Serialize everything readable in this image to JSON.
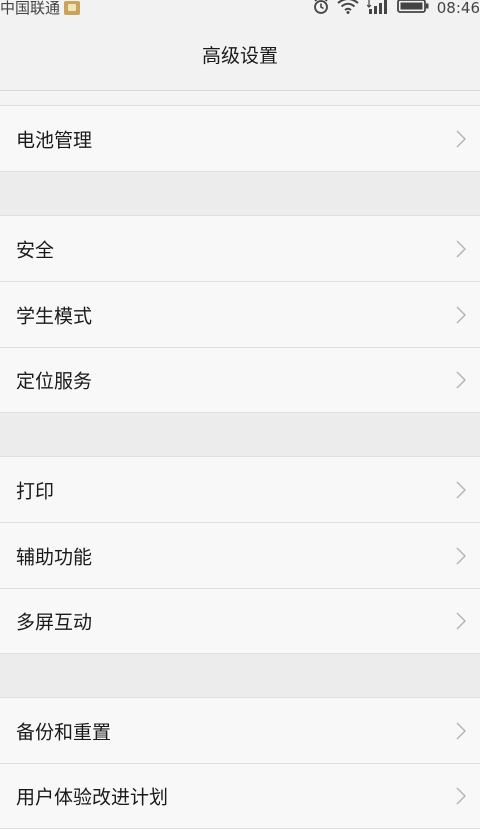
{
  "status_bar": {
    "carrier": "中国联通",
    "time": "08:46",
    "icons": [
      "alarm-icon",
      "wifi-icon",
      "signal-icon",
      "battery-icon"
    ]
  },
  "title_bar": {
    "title": "高级设置"
  },
  "groups": [
    {
      "items": [
        {
          "label": "电池管理",
          "icon": "chevron-right-icon"
        }
      ]
    },
    {
      "items": [
        {
          "label": "安全",
          "icon": "chevron-right-icon"
        },
        {
          "label": "学生模式",
          "icon": "chevron-right-icon"
        },
        {
          "label": "定位服务",
          "icon": "chevron-right-icon"
        }
      ]
    },
    {
      "items": [
        {
          "label": "打印",
          "icon": "chevron-right-icon"
        },
        {
          "label": "辅助功能",
          "icon": "chevron-right-icon"
        },
        {
          "label": "多屏互动",
          "icon": "chevron-right-icon"
        }
      ]
    },
    {
      "items": [
        {
          "label": "备份和重置",
          "icon": "chevron-right-icon"
        },
        {
          "label": "用户体验改进计划",
          "icon": "chevron-right-icon"
        }
      ]
    }
  ],
  "colors": {
    "background": "#f7f7f7",
    "separator": "#ececec",
    "chevron": "#b5b5b5"
  }
}
